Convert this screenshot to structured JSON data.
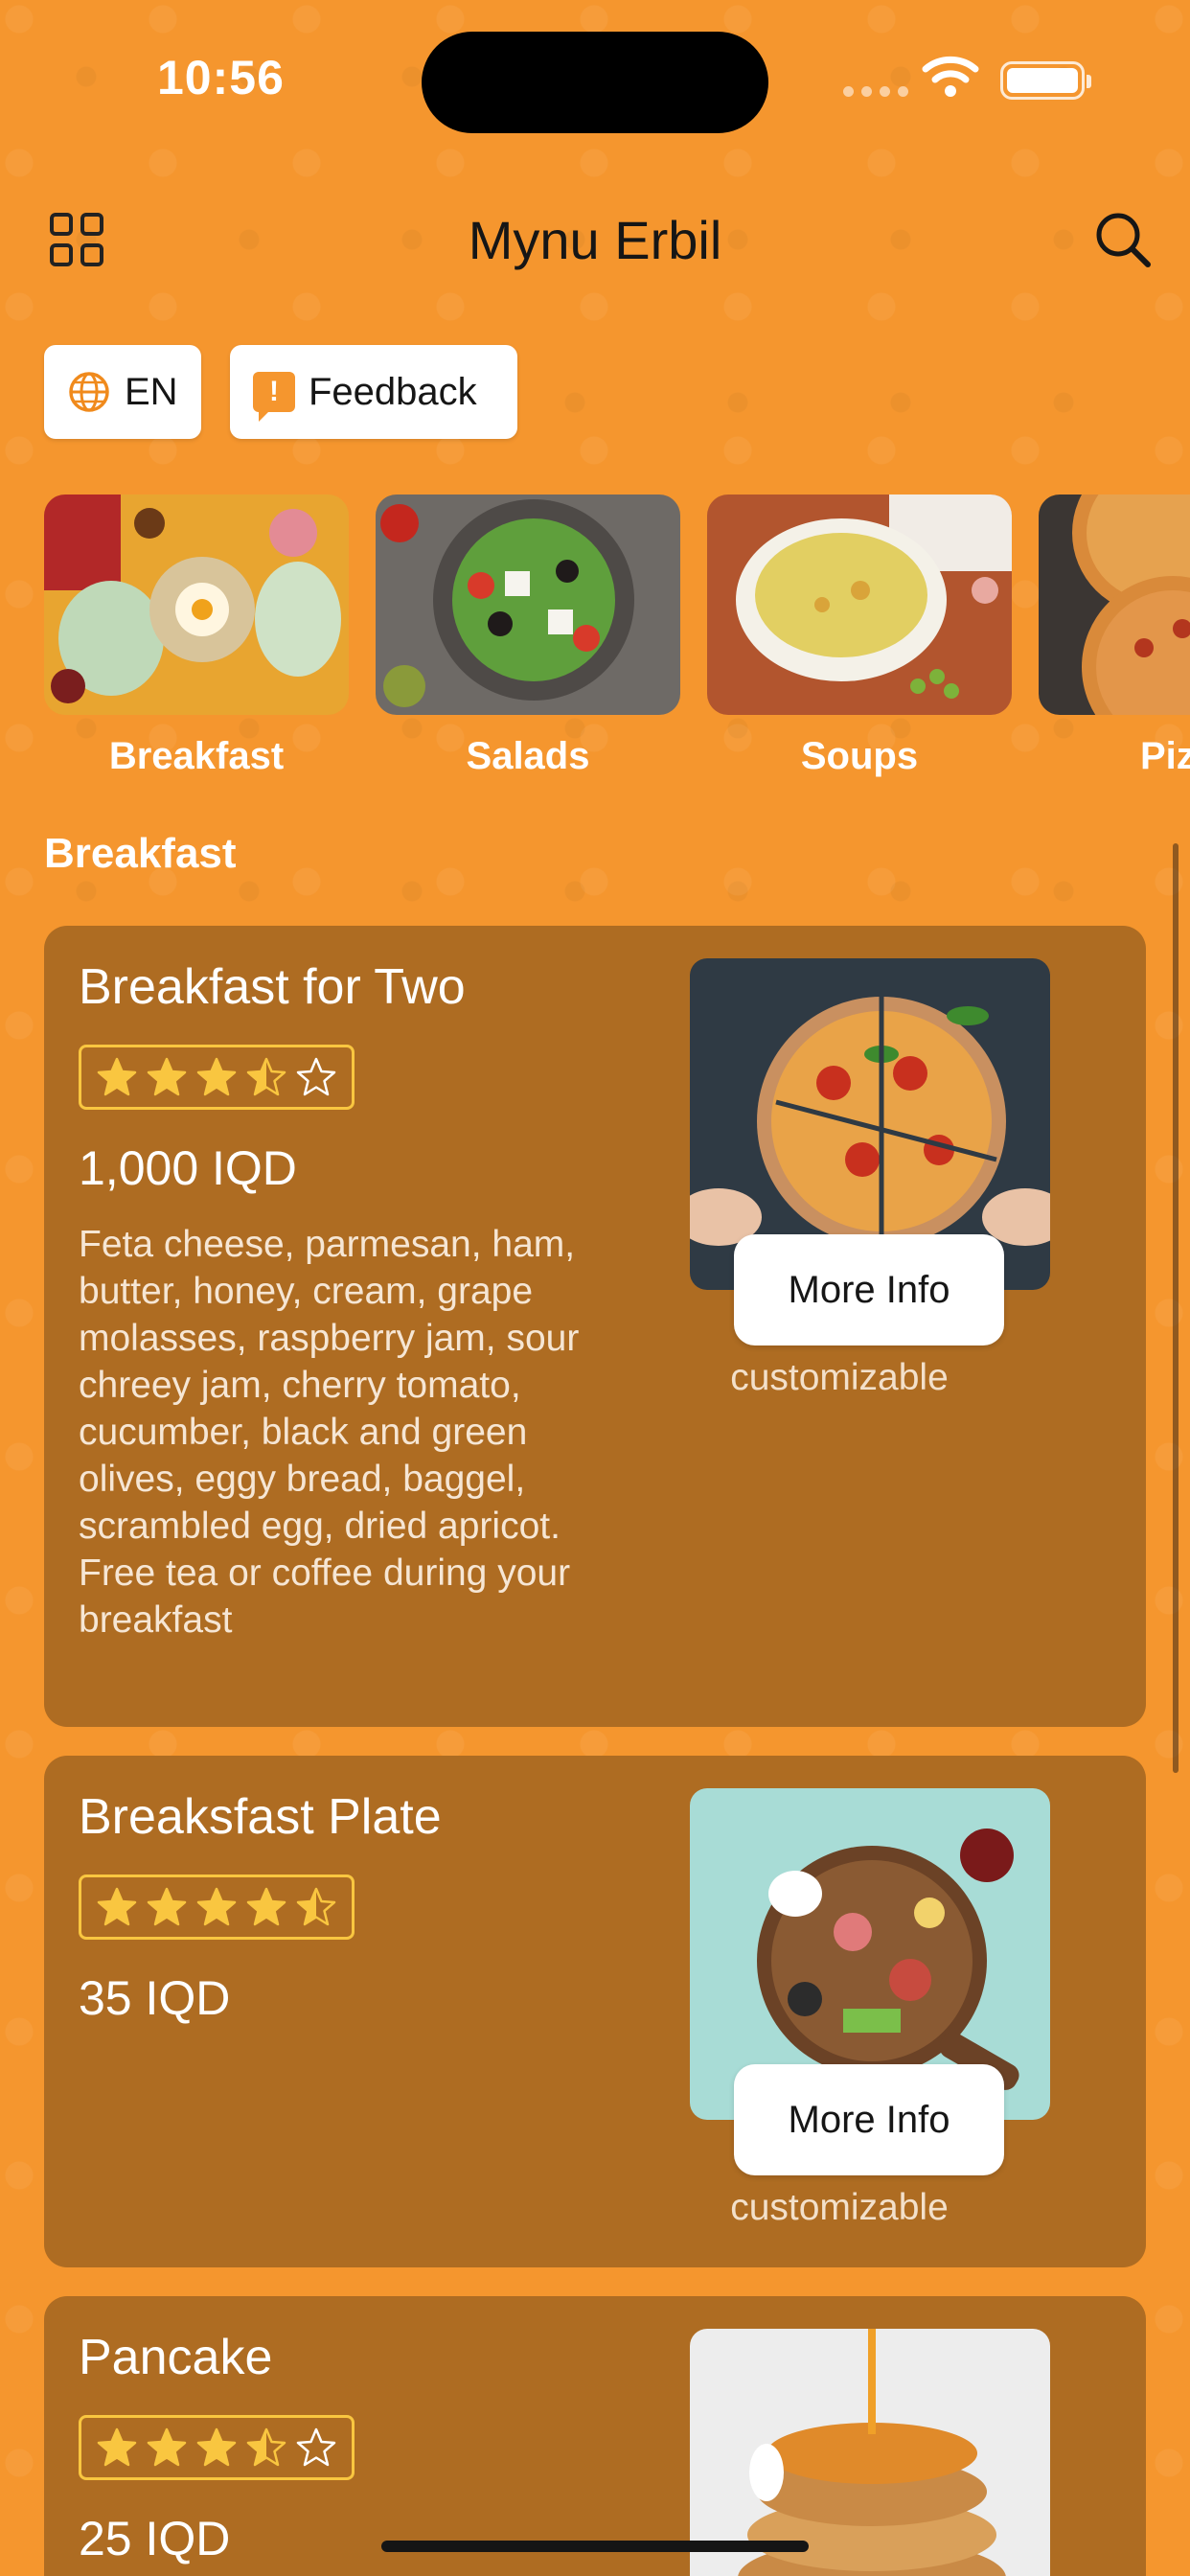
{
  "status_bar": {
    "time": "10:56"
  },
  "header": {
    "title": "Mynu Erbil"
  },
  "chips": {
    "language": "EN",
    "feedback": "Feedback",
    "feedback_symbol": "!"
  },
  "categories": [
    {
      "label": "Breakfast"
    },
    {
      "label": "Salads"
    },
    {
      "label": "Soups"
    },
    {
      "label": "Piz"
    }
  ],
  "section": {
    "title": "Breakfast"
  },
  "items": [
    {
      "title": "Breakfast for Two",
      "rating": 3.5,
      "price": "1,000 IQD",
      "description": "Feta cheese, parmesan, ham, butter, honey, cream, grape molasses, raspberry jam, sour chreey jam, cherry tomato, cucumber, black and green olives, eggy bread, baggel, scrambled egg, dried apricot. Free tea or coffee during your breakfast",
      "button": "More Info",
      "tag": "customizable"
    },
    {
      "title": "Breaksfast Plate",
      "rating": 4.5,
      "price": "35 IQD",
      "button": "More Info",
      "tag": "customizable"
    },
    {
      "title": "Pancake",
      "rating": 3.5,
      "price": "25 IQD"
    }
  ],
  "colors": {
    "background": "#F5962E",
    "card": "#AE6C22",
    "star": "#F9C640"
  }
}
